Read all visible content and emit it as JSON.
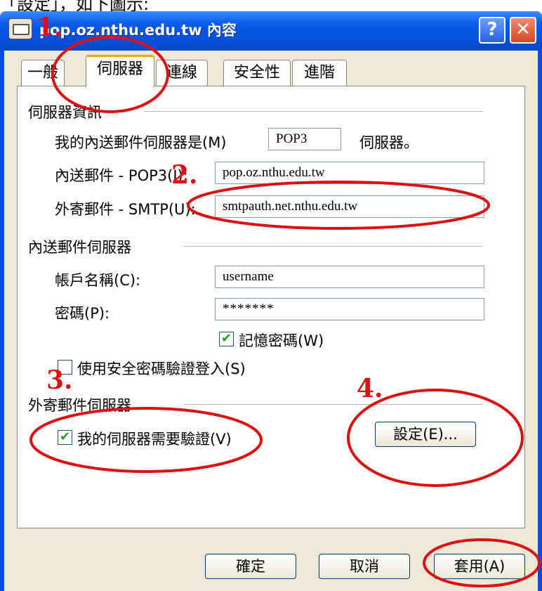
{
  "caption_fragment": "「設定」，如下圖示:",
  "window": {
    "title": "pop.oz.nthu.edu.tw 內容",
    "help": "?",
    "close": "✕"
  },
  "tabs": [
    {
      "label": "一般"
    },
    {
      "label": "伺服器"
    },
    {
      "label": "連線"
    },
    {
      "label": "安全性"
    },
    {
      "label": "進階"
    }
  ],
  "server_info": {
    "heading": "伺服器資訊",
    "incoming_type_label": "我的內送郵件伺服器是(M)",
    "incoming_type_value": "POP3",
    "incoming_type_suffix": "伺服器。",
    "incoming_label": "內送郵件 - POP3(I):",
    "incoming_value": "pop.oz.nthu.edu.tw",
    "outgoing_label": "外寄郵件 - SMTP(U):",
    "outgoing_value": "smtpauth.net.nthu.edu.tw"
  },
  "incoming_server": {
    "heading": "內送郵件伺服器",
    "account_label": "帳戶名稱(C):",
    "account_value": "username",
    "password_label": "密碼(P):",
    "password_value": "*******",
    "remember_label": "記憶密碼(W)",
    "remember_checked": true,
    "spa_label": "使用安全密碼驗證登入(S)",
    "spa_checked": false
  },
  "outgoing_server": {
    "heading": "外寄郵件伺服器",
    "auth_label": "我的伺服器需要驗證(V)",
    "auth_checked": true,
    "settings_button": "設定(E)..."
  },
  "footer": {
    "ok": "確定",
    "cancel": "取消",
    "apply": "套用(A)"
  },
  "annotations": {
    "step1": "1.",
    "step2": "2.",
    "step3": "3.",
    "step4": "4.",
    "color": "#dd1111"
  },
  "check_mark": "✔"
}
